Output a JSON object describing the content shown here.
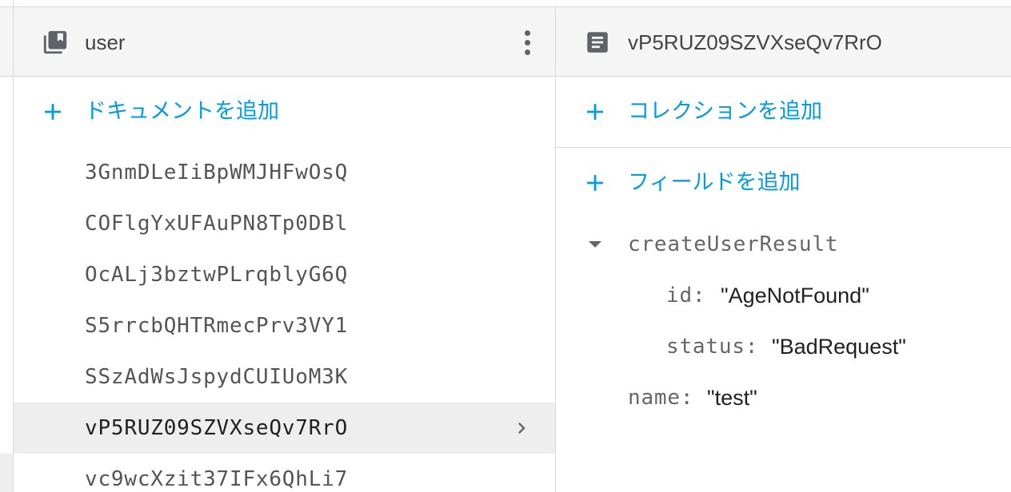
{
  "collection_panel": {
    "title": "user",
    "icon": "collection-icon",
    "add_document_label": "ドキュメントを追加",
    "documents": [
      {
        "id": "3GnmDLeIiBpWMJHFwOsQ",
        "selected": false
      },
      {
        "id": "COFlgYxUFAuPN8Tp0DBl",
        "selected": false
      },
      {
        "id": "OcALj3bztwPLrqblyG6Q",
        "selected": false
      },
      {
        "id": "S5rrcbQHTRmecPrv3VY1",
        "selected": false
      },
      {
        "id": "SSzAdWsJspydCUIUoM3K",
        "selected": false
      },
      {
        "id": "vP5RUZ09SZVXseQv7RrO",
        "selected": true
      },
      {
        "id": "vc9wcXzit37IFx6QhLi7",
        "selected": false
      }
    ]
  },
  "document_panel": {
    "title": "vP5RUZ09SZVXseQv7RrO",
    "icon": "document-icon",
    "add_collection_label": "コレクションを追加",
    "add_field_label": "フィールドを追加",
    "fields": {
      "map_key": "createUserResult",
      "id_key": "id:",
      "id_value": "\"AgeNotFound\"",
      "status_key": "status:",
      "status_value": "\"BadRequest\"",
      "name_key": "name:",
      "name_value": "\"test\""
    }
  },
  "colors": {
    "accent": "#039be5",
    "header_bg": "#f5f5f5",
    "selected_bg": "#eeeeee",
    "divider": "#dadada"
  }
}
